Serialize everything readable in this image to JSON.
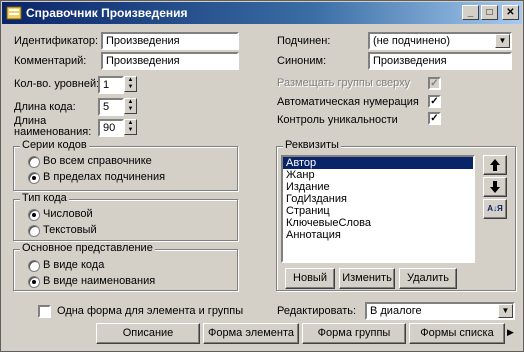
{
  "window": {
    "title": "Справочник Произведения",
    "minimize": "_",
    "maximize": "□",
    "close": "✕"
  },
  "fields": {
    "identifier_label": "Идентификатор:",
    "identifier_value": "Произведения",
    "comment_label": "Комментарий:",
    "comment_value": "Произведения",
    "levels_label": "Кол-во. уровней:",
    "levels_value": "1",
    "code_length_label": "Длина кода:",
    "code_length_value": "5",
    "name_length_label_1": "Длина",
    "name_length_label_2": "наименования:",
    "name_length_value": "90",
    "subordinate_label": "Подчинен:",
    "subordinate_value": "(не подчинено)",
    "synonym_label": "Синоним:",
    "synonym_value": "Произведения"
  },
  "options": {
    "groups_on_top": "Размещать группы сверху",
    "auto_numbering": "Автоматическая нумерация",
    "uniqueness_check": "Контроль уникальности"
  },
  "code_series": {
    "title": "Серии кодов",
    "options": [
      "Во всем справочнике",
      "В пределах подчинения"
    ],
    "selected": 1
  },
  "code_type": {
    "title": "Тип кода",
    "options": [
      "Числовой",
      "Текстовый"
    ],
    "selected": 0
  },
  "main_view": {
    "title": "Основное представление",
    "options": [
      "В виде кода",
      "В виде наименования"
    ],
    "selected": 1
  },
  "requisites": {
    "title": "Реквизиты",
    "items": [
      "Автор",
      "Жанр",
      "Издание",
      "ГодИздания",
      "Страниц",
      "КлючевыеСлова",
      "Аннотация"
    ],
    "selected": 0,
    "new_button": "Новый",
    "edit_button": "Изменить",
    "delete_button": "Удалить",
    "sort_icon_text": "А↓Я"
  },
  "bottom": {
    "one_form_label": "Одна форма для элемента и группы",
    "edit_label": "Редактировать:",
    "edit_value": "В диалоге"
  },
  "footer_buttons": {
    "description": "Описание",
    "element_form": "Форма элемента",
    "group_form": "Форма группы",
    "list_forms": "Формы списка"
  }
}
